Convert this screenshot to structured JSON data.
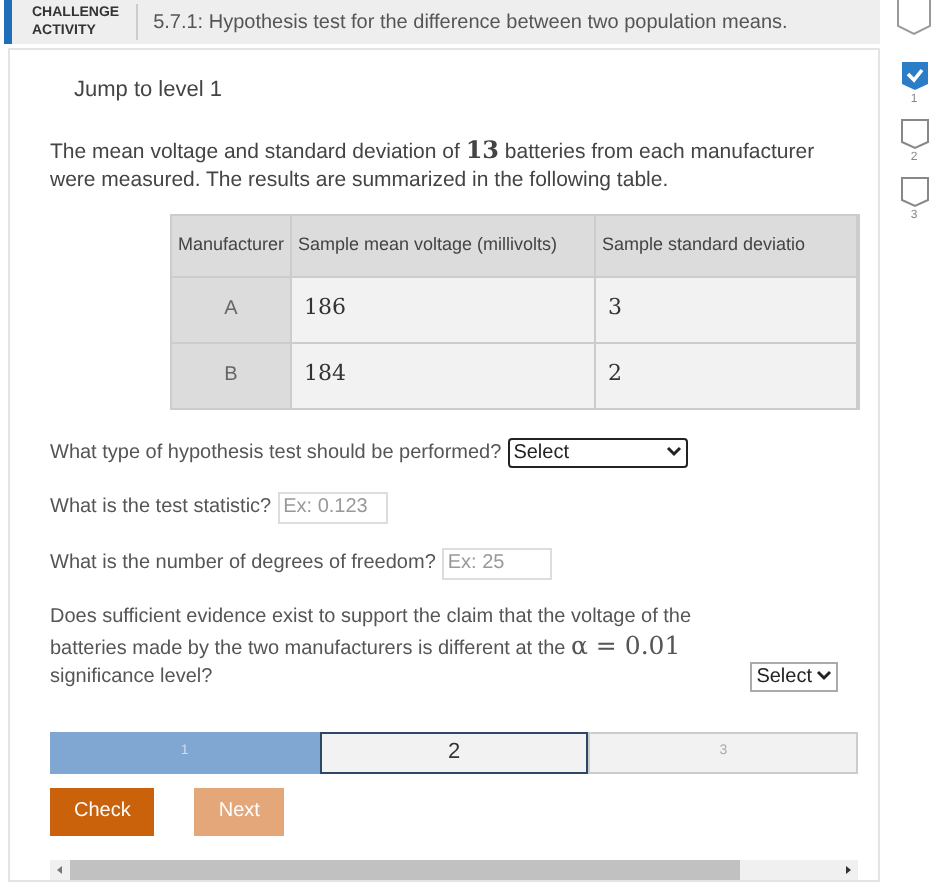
{
  "header": {
    "badge_lines": [
      "CHALLENGE",
      "ACTIVITY"
    ],
    "title": "5.7.1: Hypothesis test for the difference between two population means."
  },
  "levels": [
    {
      "label": "1",
      "checked": true
    },
    {
      "label": "2",
      "checked": false
    },
    {
      "label": "3",
      "checked": false
    }
  ],
  "jump_link": "Jump to level 1",
  "intro": {
    "before": "The mean voltage and standard deviation of ",
    "math": "13",
    "after": " batteries from each manufacturer were measured. The results are summarized in the following table."
  },
  "table": {
    "columns": [
      "Manufacturer",
      "Sample mean voltage (millivolts)",
      "Sample standard deviatio"
    ],
    "rows": [
      [
        "A",
        "186",
        "3"
      ],
      [
        "B",
        "184",
        "2"
      ]
    ]
  },
  "questions": [
    {
      "kind": "select",
      "label": "What type of hypothesis test should be performed?",
      "value": "Select",
      "focused": true
    },
    {
      "kind": "input",
      "label": "What is the test statistic?",
      "placeholder": "Ex: 0.123"
    },
    {
      "kind": "input",
      "label": "What is the number of degrees of freedom?",
      "placeholder": "Ex: 25"
    },
    {
      "kind": "inline_select",
      "before": "Does sufficient evidence exist to support the claim that the voltage of the batteries made by the two manufacturers is different at the ",
      "math": "α = 0.01",
      "after": " significance level?",
      "value": "Select",
      "focused": false
    }
  ],
  "progress": [
    {
      "label": "1",
      "completed": true,
      "selected": false
    },
    {
      "label": "2",
      "completed": false,
      "selected": true
    },
    {
      "label": "3",
      "completed": false,
      "selected": false
    }
  ],
  "buttons": [
    {
      "label": "Check",
      "disabled": false
    },
    {
      "label": "Next",
      "disabled": true
    }
  ]
}
